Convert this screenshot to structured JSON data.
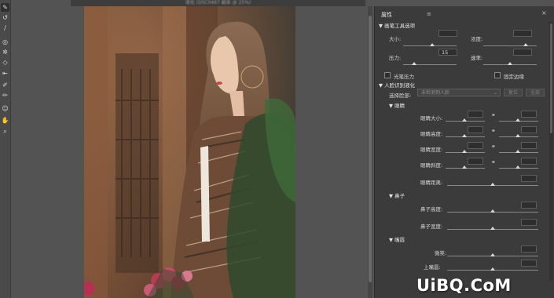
{
  "document": {
    "title": "液化 (DSC0467 副本 @ 25%)"
  },
  "tools": [
    {
      "name": "forward-warp-tool-icon",
      "glyph": "✎"
    },
    {
      "name": "reconstruct-tool-icon",
      "glyph": "↺"
    },
    {
      "name": "smooth-tool-icon",
      "glyph": "∕"
    },
    {
      "name": "twirl-tool-icon",
      "glyph": "◎"
    },
    {
      "name": "pucker-tool-icon",
      "glyph": "✲"
    },
    {
      "name": "bloat-tool-icon",
      "glyph": "◇"
    },
    {
      "name": "push-left-tool-icon",
      "glyph": "⇤"
    },
    {
      "name": "freeze-mask-tool-icon",
      "glyph": "✐"
    },
    {
      "name": "thaw-mask-tool-icon",
      "glyph": "✏"
    },
    {
      "name": "face-tool-icon",
      "glyph": "☺"
    },
    {
      "name": "hand-tool-icon",
      "glyph": "✋"
    },
    {
      "name": "zoom-tool-icon",
      "glyph": "⌕"
    }
  ],
  "panel": {
    "title": "属性",
    "menu_icon": "≡",
    "close_icon": "×",
    "brush_section": {
      "header": "画笔工具选项",
      "size_label": "大小:",
      "size_value": "",
      "density_label": "浓度:",
      "density_value": "",
      "pressure_label": "压力:",
      "pressure_value": "15",
      "rate_label": "速率:",
      "rate_value": "",
      "stylus_label": "光笔压力",
      "pin_edges_label": "固定边缘",
      "size_level": 0.55,
      "density_level": 0.8,
      "pressure_level": 0.2,
      "rate_level": 0.5
    },
    "face_section": {
      "header": "人脸识别液化",
      "select_face_label": "选择脸部:",
      "select_face_value": "未检测到人脸",
      "reset_button": "复位",
      "all_button": "全部",
      "eyes": {
        "header": "眼睛",
        "rows": [
          {
            "label": "眼睛大小:",
            "name": "eye-size"
          },
          {
            "label": "眼睛高度:",
            "name": "eye-height"
          },
          {
            "label": "眼睛宽度:",
            "name": "eye-width"
          },
          {
            "label": "眼睛斜度:",
            "name": "eye-tilt"
          },
          {
            "label": "眼睛距离:",
            "name": "eye-distance"
          }
        ]
      },
      "nose": {
        "header": "鼻子",
        "rows": [
          {
            "label": "鼻子高度:",
            "name": "nose-height"
          },
          {
            "label": "鼻子宽度:",
            "name": "nose-width"
          }
        ]
      },
      "mouth": {
        "header": "嘴唇",
        "rows": [
          {
            "label": "微笑:",
            "name": "smile"
          },
          {
            "label": "上嘴唇:",
            "name": "upper-lip"
          }
        ]
      }
    }
  },
  "watermark": "UiBQ.CoM",
  "colors": {
    "panel_bg": "#3b3b3b",
    "canvas_bg": "#535353",
    "toolbar_bg": "#4a4a4a"
  }
}
